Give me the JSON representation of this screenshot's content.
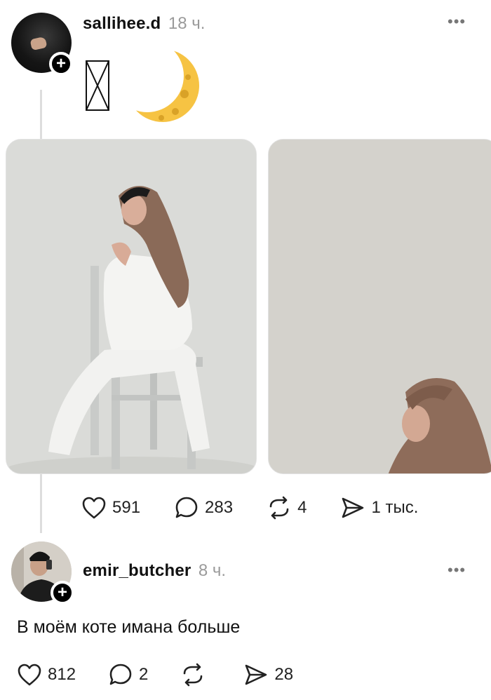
{
  "posts": [
    {
      "author": "sallihee.d",
      "time_ago": "18 ч.",
      "more_label": "•••",
      "follow_label": "+",
      "emoji": "🌙",
      "likes": "591",
      "comments": "283",
      "reposts": "4",
      "shares": "1 тыс."
    },
    {
      "author": "emir_butcher",
      "time_ago": "8 ч.",
      "more_label": "•••",
      "follow_label": "+",
      "text": "В моём коте имана больше",
      "likes": "812",
      "comments": "2",
      "reposts": "",
      "shares": "28"
    }
  ],
  "icons": {
    "like": "heart-icon",
    "comment": "comment-bubble-icon",
    "repost": "repost-icon",
    "share": "send-icon",
    "more": "more-dots-icon"
  },
  "colors": {
    "text": "#111111",
    "muted": "#9a9a9a",
    "thread_line": "#dddddd",
    "moon": "#f6c343"
  }
}
